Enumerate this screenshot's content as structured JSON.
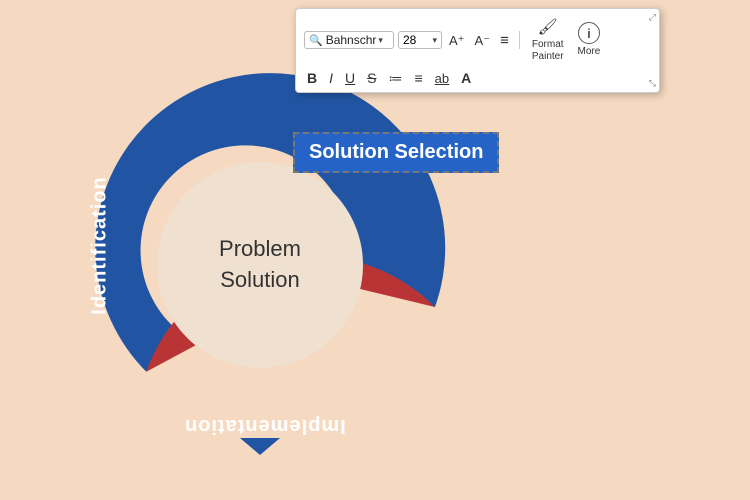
{
  "toolbar": {
    "font_name": "Bahnschr",
    "font_size": "28",
    "resize_corner_tl": "↗",
    "resize_corner_br": "↙",
    "buttons_row1": [
      {
        "label": "A⁺",
        "name": "font-increase"
      },
      {
        "label": "A⁻",
        "name": "font-decrease"
      },
      {
        "label": "≡",
        "name": "text-align"
      },
      {
        "label": "✏",
        "name": "format-painter-icon"
      },
      {
        "label": "ⓘ",
        "name": "more-icon"
      }
    ],
    "buttons_row2": [
      {
        "label": "B",
        "name": "bold",
        "style": "bold"
      },
      {
        "label": "I",
        "name": "italic",
        "style": "italic"
      },
      {
        "label": "U",
        "name": "underline"
      },
      {
        "label": "S̶",
        "name": "strikethrough"
      },
      {
        "label": "≔",
        "name": "numbered-list"
      },
      {
        "label": "•≡",
        "name": "bullet-list"
      },
      {
        "label": "ab",
        "name": "text-style"
      },
      {
        "label": "A",
        "name": "font-color"
      }
    ],
    "format_painter_label": "Format\nPainter",
    "more_label": "More"
  },
  "diagram": {
    "center_line1": "Problem",
    "center_line2": "Solution",
    "solution_selection_label": "Solution Selection",
    "identification_label": "Identification",
    "implementation_label": "Implementation",
    "colors": {
      "blue": "#2155a3",
      "red": "#b93535",
      "cream": "#f0e0d0"
    }
  }
}
